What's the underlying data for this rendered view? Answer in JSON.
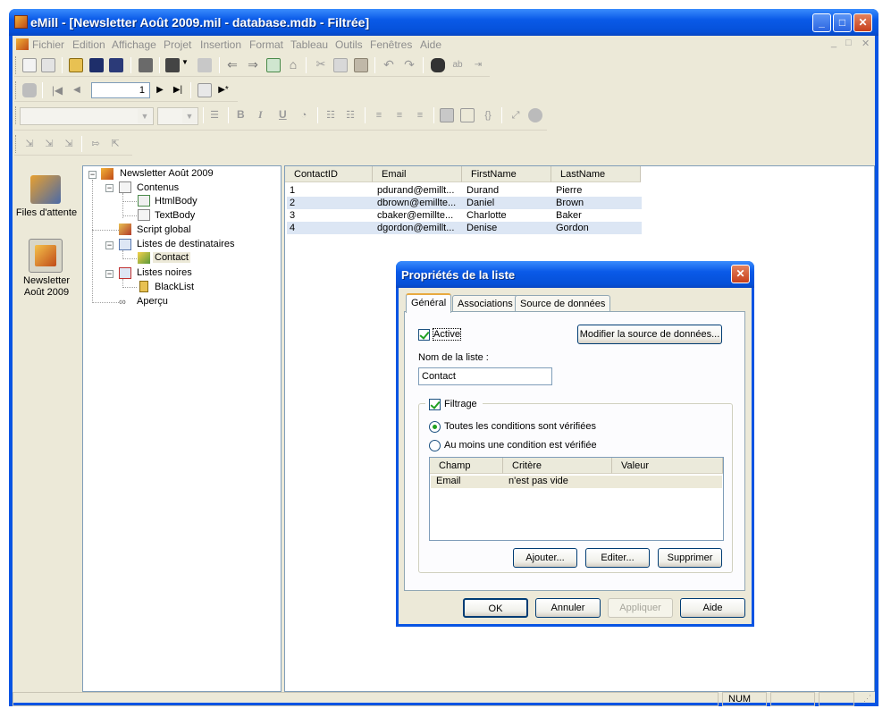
{
  "window": {
    "title": "eMill - [Newsletter Août 2009.mil - database.mdb - Filtrée]",
    "controls": {
      "minimize": "_",
      "maximize": "□",
      "close": "✕"
    }
  },
  "menu": [
    "Fichier",
    "Edition",
    "Affichage",
    "Projet",
    "Insertion",
    "Format",
    "Tableau",
    "Outils",
    "Fenêtres",
    "Aide"
  ],
  "mdi_controls": [
    "_",
    "□",
    "✕"
  ],
  "toolbar_nav": {
    "record_value": "1"
  },
  "left_pane": {
    "shortcuts": [
      {
        "label": "Files d'attente",
        "icon": "queue-icon"
      },
      {
        "label": "Newsletter Août 2009",
        "icon": "newsletter-icon"
      }
    ]
  },
  "tree": {
    "root": "Newsletter Août 2009",
    "contenus": "Contenus",
    "html_body": "HtmlBody",
    "text_body": "TextBody",
    "script_global": "Script global",
    "listes_dest": "Listes de destinataires",
    "contact": "Contact",
    "listes_noires": "Listes noires",
    "blacklist": "BlackList",
    "apercu": "Aperçu"
  },
  "grid": {
    "columns": [
      "ContactID",
      "Email",
      "FirstName",
      "LastName"
    ],
    "rows": [
      {
        "id": "1",
        "email": "pdurand@emillt...",
        "first": "Durand",
        "last": "Pierre"
      },
      {
        "id": "2",
        "email": "dbrown@emillte...",
        "first": "Daniel",
        "last": "Brown"
      },
      {
        "id": "3",
        "email": "cbaker@emillte...",
        "first": "Charlotte",
        "last": "Baker"
      },
      {
        "id": "4",
        "email": "dgordon@emillt...",
        "first": "Denise",
        "last": "Gordon"
      }
    ]
  },
  "status": {
    "num": "NUM"
  },
  "dialog": {
    "title": "Propriétés de la liste",
    "tabs": [
      "Général",
      "Associations",
      "Source de données"
    ],
    "active_label": "Active",
    "active_checked": true,
    "modify_source_btn": "Modifier la source de données...",
    "list_name_label": "Nom de la liste :",
    "list_name_value": "Contact",
    "filter_label": "Filtrage",
    "filter_checked": true,
    "radio_all": "Toutes les conditions sont vérifiées",
    "radio_any": "Au moins une condition est vérifiée",
    "radio_selected": "all",
    "conditions_columns": [
      "Champ",
      "Critère",
      "Valeur"
    ],
    "conditions": [
      {
        "champ": "Email",
        "critere": "n'est pas vide",
        "valeur": ""
      }
    ],
    "btn_add": "Ajouter...",
    "btn_edit": "Editer...",
    "btn_delete": "Supprimer",
    "btn_ok": "OK",
    "btn_cancel": "Annuler",
    "btn_apply": "Appliquer",
    "btn_help": "Aide"
  }
}
